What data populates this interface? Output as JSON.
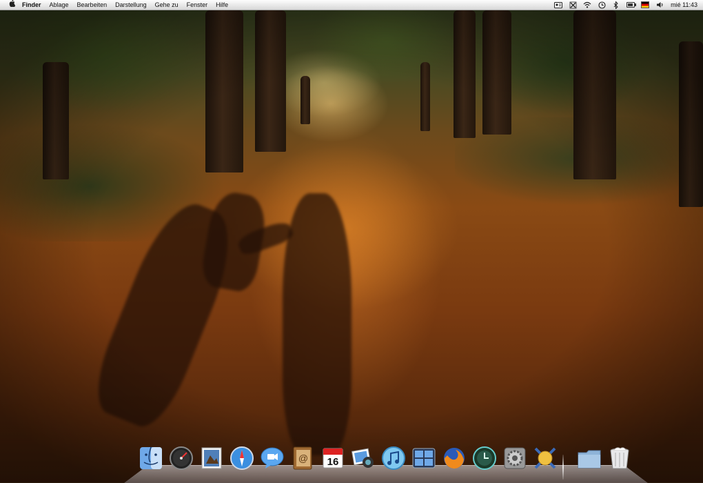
{
  "menubar": {
    "app_name": "Finder",
    "menus": [
      "Ablage",
      "Bearbeiten",
      "Darstellung",
      "Gehe zu",
      "Fenster",
      "Hilfe"
    ],
    "status_icons": [
      "id-card-icon",
      "spotlight-sync-icon",
      "wifi-icon",
      "time-machine-icon",
      "bluetooth-icon",
      "battery-icon",
      "german-flag-icon",
      "volume-icon"
    ],
    "clock": "mié 11:43"
  },
  "dock": {
    "apps": [
      "finder-icon",
      "dashboard-icon",
      "preview-icon",
      "safari-icon",
      "ichat-icon",
      "address-book-icon",
      "ical-icon",
      "iphoto-icon",
      "itunes-icon",
      "spaces-icon",
      "firefox-icon",
      "time-machine-icon",
      "system-preferences-icon",
      "network-utility-icon"
    ],
    "stacks": [
      "documents-folder-icon",
      "trash-icon"
    ],
    "ical_day": "16"
  },
  "wallpaper": {
    "subject": "autumn-leaf-covered-alley"
  }
}
